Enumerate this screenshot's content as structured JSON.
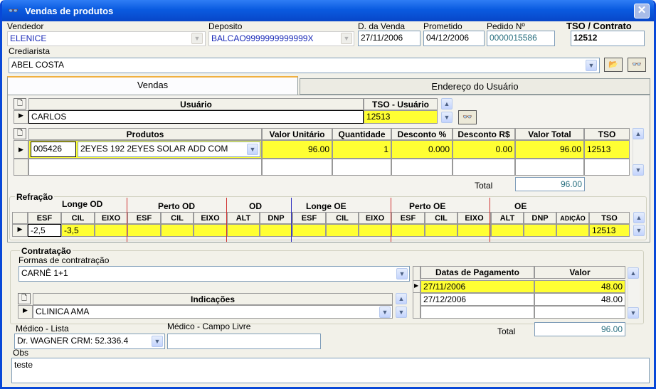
{
  "window": {
    "title": "Vendas de produtos",
    "close": "✕"
  },
  "header": {
    "vendedor_label": "Vendedor",
    "vendedor": "ELENICE",
    "deposito_label": "Deposito",
    "deposito": "BALCAO9999999999999X",
    "dvenda_label": "D. da Venda",
    "dvenda": "27/11/2006",
    "prometido_label": "Prometido",
    "prometido": "04/12/2006",
    "pedido_label": "Pedido Nº",
    "pedido": "0000015586",
    "tso_label": "TSO / Contrato",
    "tso": "12512",
    "crediarista_label": "Crediarista",
    "crediarista": "ABEL COSTA"
  },
  "tabs": {
    "vendas": "Vendas",
    "endereco": "Endereço do Usuário"
  },
  "usuario": {
    "col_usuario": "Usuário",
    "col_tso": "TSO - Usuário",
    "nome": "CARLOS",
    "tso": "12513"
  },
  "produtos": {
    "cols": [
      "Produtos",
      "Valor Unitário",
      "Quantidade",
      "Desconto %",
      "Desconto R$",
      "Valor Total",
      "TSO"
    ],
    "row": {
      "codigo": "005426",
      "descricao": "2EYES  192  2EYES SOLAR   ADD COM",
      "valor_unit": "96.00",
      "qtd": "1",
      "desc_pct": "0.000",
      "desc_rs": "0.00",
      "total": "96.00",
      "tso": "12513"
    },
    "total_label": "Total",
    "total": "96.00"
  },
  "refracao": {
    "title": "Refração",
    "groups": [
      "Longe  OD",
      "Perto  OD",
      "OD",
      "Longe  OE",
      "Perto  OE",
      "OE"
    ],
    "cols": [
      "ESF",
      "CIL",
      "EIXO",
      "ESF",
      "CIL",
      "EIXO",
      "ALT",
      "DNP",
      "ESF",
      "CIL",
      "EIXO",
      "ESF",
      "CIL",
      "EIXO",
      "ALT",
      "DNP",
      "ADIÇÃO",
      "TSO"
    ],
    "esf": "-2,5",
    "cil": "-3,5",
    "tso": "12513"
  },
  "contratacao": {
    "title": "Contratação",
    "formas_label": "Formas de contratração",
    "forma": "CARNÊ 1+1",
    "indicacoes_label": "Indicações",
    "indicacao": "CLINICA AMA",
    "pagamentos_cols": [
      "Datas de Pagamento",
      "Valor"
    ],
    "pagamentos": [
      {
        "data": "27/11/2006",
        "valor": "48.00"
      },
      {
        "data": "27/12/2006",
        "valor": "48.00"
      }
    ],
    "total_label": "Total",
    "total": "96.00"
  },
  "medico": {
    "lista_label": "Médico - Lista",
    "lista": "Dr. WAGNER CRM: 52.336.4",
    "livre_label": "Médico - Campo Livre",
    "livre": ""
  },
  "obs": {
    "label": "Obs",
    "text": "teste"
  }
}
